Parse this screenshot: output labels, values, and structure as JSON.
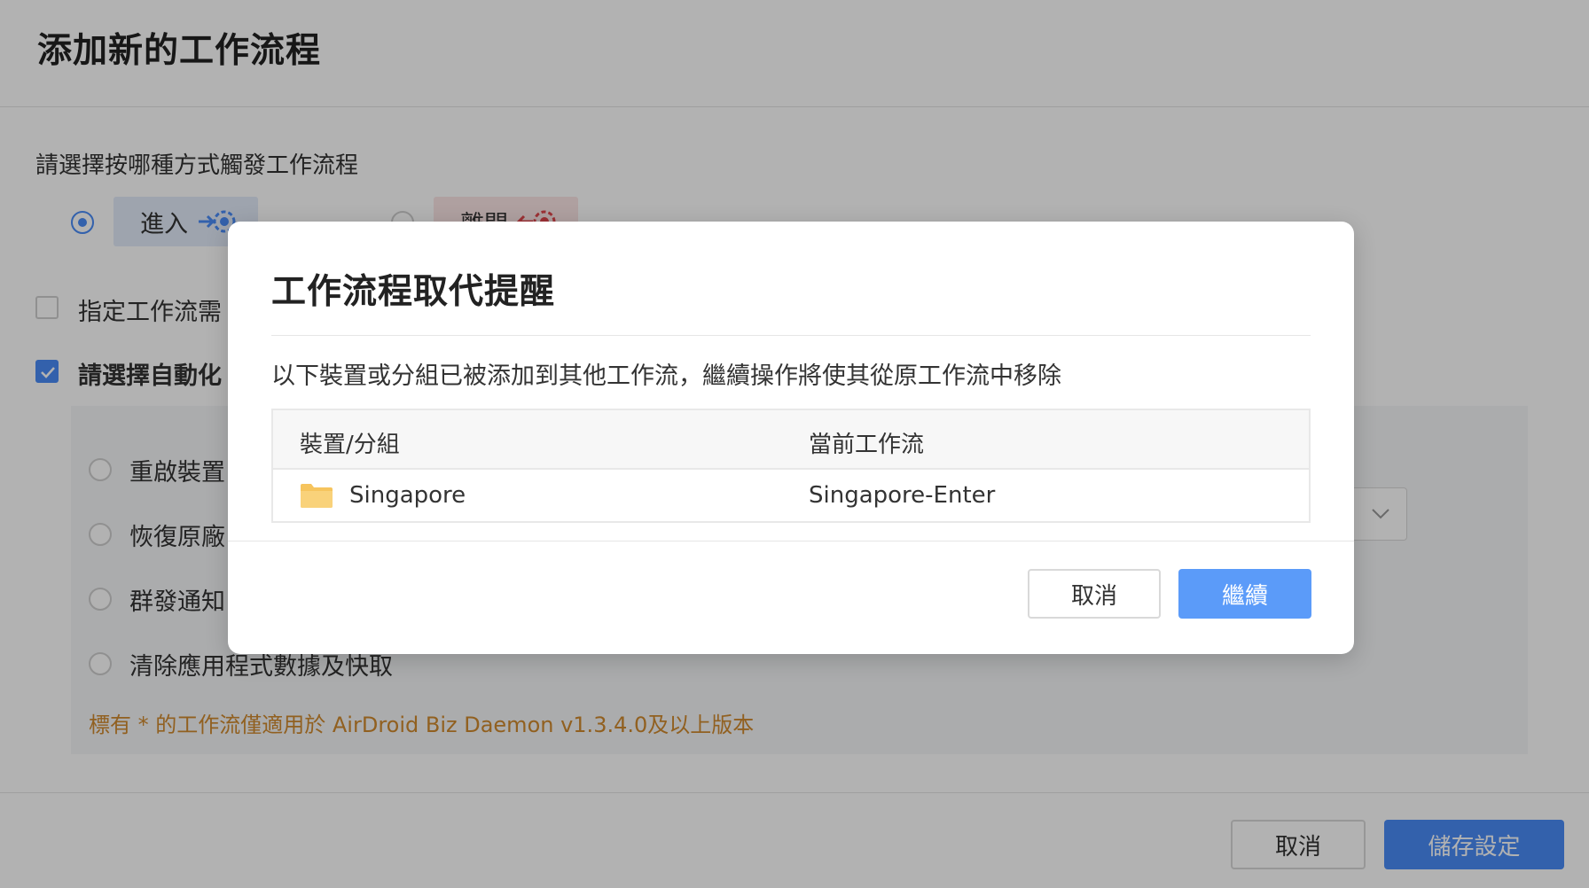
{
  "page": {
    "title": "添加新的工作流程",
    "trigger_question": "請選擇按哪種方式觸發工作流程",
    "triggers": [
      {
        "label": "進入",
        "selected": true,
        "icon": "enter-geofence-icon",
        "color": "#4a8cf7"
      },
      {
        "label": "離開",
        "selected": false,
        "icon": "leave-geofence-icon",
        "color": "#e0474c"
      }
    ],
    "option_specify": {
      "label": "指定工作流需",
      "checked": false
    },
    "option_actions": {
      "label": "請選擇自動化",
      "checked": true
    },
    "actions": [
      {
        "label": "重啟裝置"
      },
      {
        "label": "恢復原廠"
      },
      {
        "label": "群發通知"
      },
      {
        "label": "清除應用程式數據及快取"
      }
    ],
    "note": "標有 * 的工作流僅適用於 AirDroid Biz Daemon v1.3.4.0及以上版本",
    "footer": {
      "cancel": "取消",
      "save": "儲存設定"
    }
  },
  "modal": {
    "title": "工作流程取代提醒",
    "message": "以下裝置或分組已被添加到其他工作流，繼續操作將使其從原工作流中移除",
    "columns": [
      "裝置/分組",
      "當前工作流"
    ],
    "rows": [
      {
        "name": "Singapore",
        "icon": "folder-icon",
        "workflow": "Singapore-Enter"
      }
    ],
    "cancel": "取消",
    "continue": "繼續"
  },
  "colors": {
    "accent": "#4a8cf7",
    "note": "#d08a2e",
    "folder": "#f6c45d"
  }
}
